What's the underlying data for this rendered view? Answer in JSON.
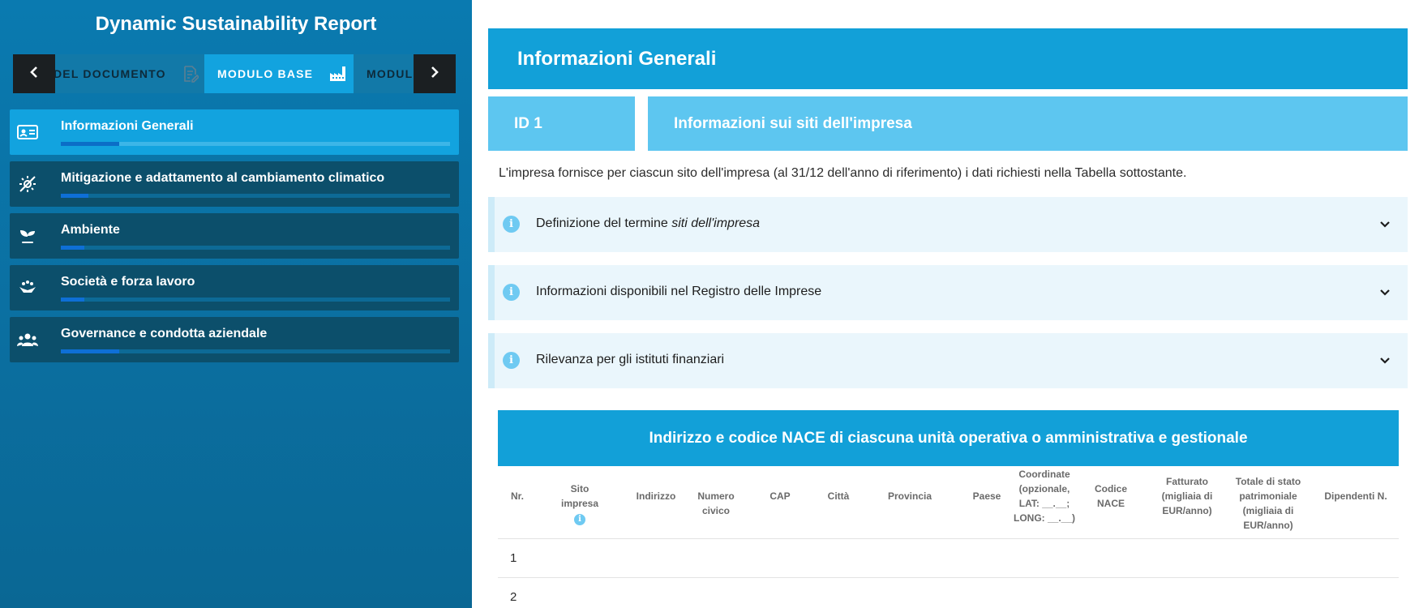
{
  "sidebar": {
    "title": "Dynamic Sustainability Report",
    "tabs": [
      {
        "label": "DEL DOCUMENTO",
        "icon": "document-edit-icon"
      },
      {
        "label": "MODULO BASE",
        "icon": "factory-icon"
      },
      {
        "label": "MODULO",
        "icon": ""
      }
    ],
    "items": [
      {
        "label": "Informazioni Generali",
        "icon": "id-card-icon",
        "progress": 0.15
      },
      {
        "label": "Mitigazione e adattamento al cambiamento climatico",
        "icon": "climate-icon",
        "progress": 0.07
      },
      {
        "label": "Ambiente",
        "icon": "plant-icon",
        "progress": 0.06
      },
      {
        "label": "Società e forza lavoro",
        "icon": "hands-people-icon",
        "progress": 0.06
      },
      {
        "label": "Governance e condotta aziendale",
        "icon": "group-icon",
        "progress": 0.15
      }
    ]
  },
  "main": {
    "header": "Informazioni Generali",
    "id_label": "ID 1",
    "section_title": "Informazioni sui siti dell'impresa",
    "intro": "L'impresa fornisce per ciascun sito dell'impresa (al 31/12 dell'anno di riferimento) i dati richiesti nella Tabella sottostante.",
    "accordions": [
      {
        "label": "Definizione del termine ",
        "label_italic": "siti dell'impresa"
      },
      {
        "label": "Informazioni disponibili nel Registro delle Imprese",
        "label_italic": ""
      },
      {
        "label": "Rilevanza per gli istituti finanziari",
        "label_italic": ""
      }
    ],
    "table": {
      "title": "Indirizzo e codice NACE di ciascuna unità operativa o amministrativa e gestionale",
      "columns": [
        "Nr.",
        "Sito impresa",
        "Indirizzo",
        "Numero civico",
        "CAP",
        "Città",
        "Provincia",
        "Paese",
        "Coordinate (opzionale, LAT: __.__; LONG: __.__)",
        "Codice NACE",
        "Fatturato (migliaia di EUR/anno)",
        "Totale di stato patrimoniale (migliaia di EUR/anno)",
        "Dipendenti N."
      ],
      "rows": [
        "1",
        "2"
      ]
    }
  },
  "colors": {
    "sidebar_bg": "#0a7ab0",
    "accent": "#12a0d8",
    "light_accent": "#5dc6f0",
    "sidebar_item": "#0c4f6b"
  }
}
